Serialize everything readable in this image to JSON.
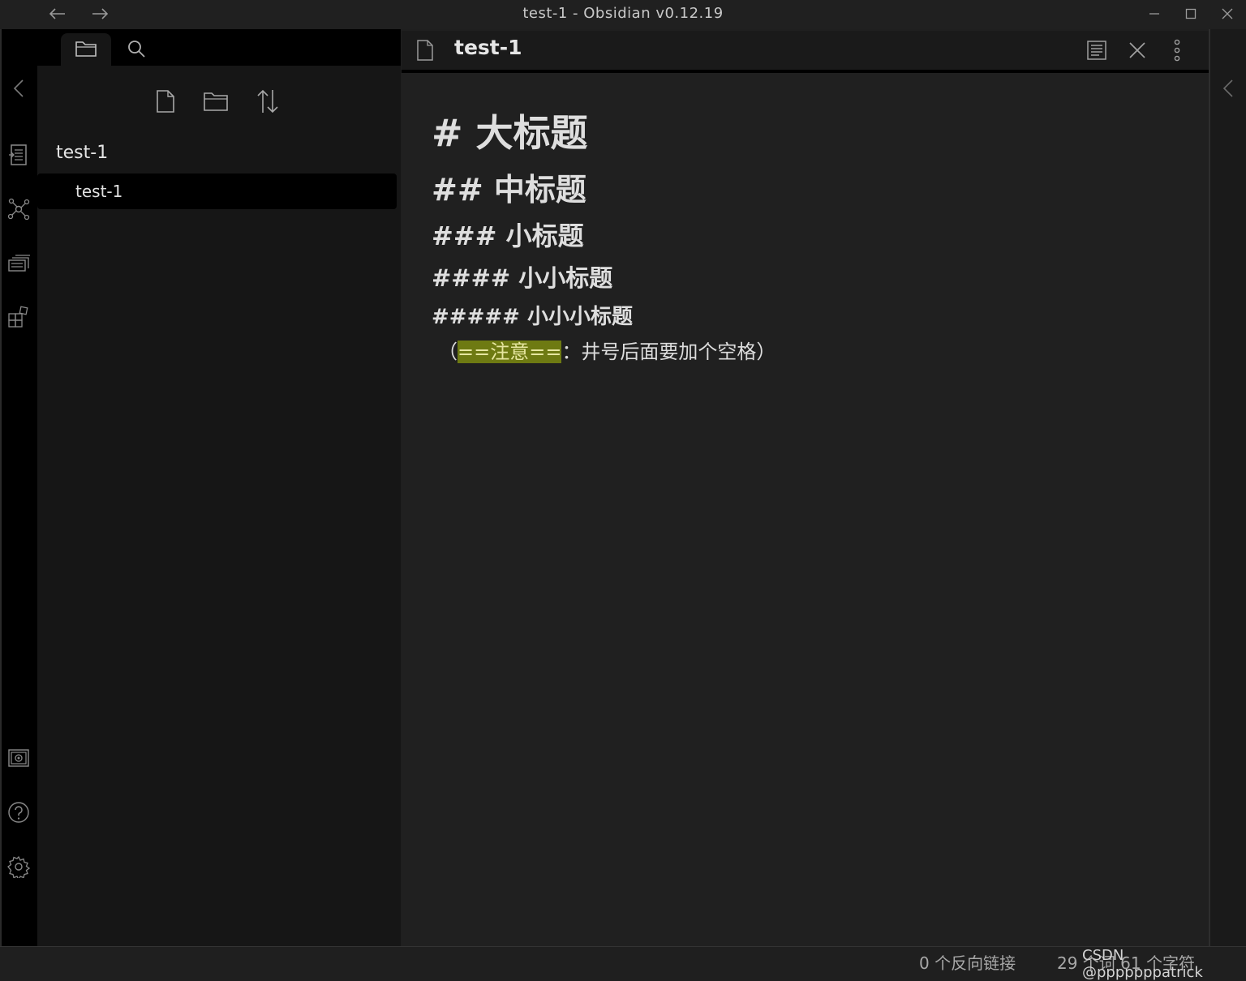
{
  "window": {
    "title": "test-1 - Obsidian v0.12.19"
  },
  "sidebar": {
    "tabs": [
      "file-explorer",
      "search"
    ],
    "toolbar_icons": [
      "new-note-icon",
      "new-folder-icon",
      "sort-icon"
    ],
    "folder": "test-1",
    "files": [
      {
        "label": "test-1",
        "active": true
      }
    ]
  },
  "editor": {
    "tab_title": "test-1",
    "lines": {
      "h1": "# 大标题",
      "h2": "## 中标题",
      "h3": "### 小标题",
      "h4": "#### 小小标题",
      "h5": "##### 小小小标题",
      "note_prefix": "（",
      "note_highlight": "==注意==",
      "note_suffix": "：井号后面要加个空格）"
    }
  },
  "status": {
    "backlinks": "0 个反向链接",
    "counts": "29 个词 61 个字符"
  },
  "watermark": "CSDN @pppppppatrick",
  "colors": {
    "highlight_bg": "#6e7a12",
    "ribbon_bg": "#000000",
    "sidebar_bg": "#161616",
    "editor_bg": "#202020"
  }
}
